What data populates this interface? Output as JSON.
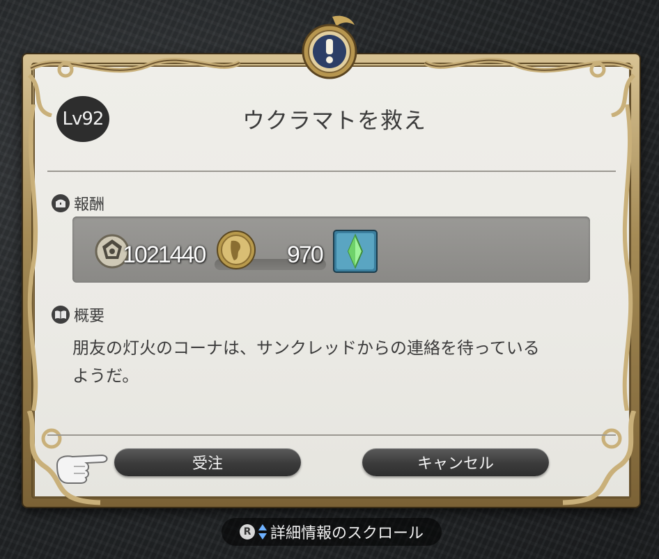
{
  "quest": {
    "level": "Lv92",
    "title": "ウクラマトを救え"
  },
  "rewards": {
    "header": "報酬",
    "gil": "1021440",
    "second_value": "970"
  },
  "summary": {
    "header": "概要",
    "text_line1": "朋友の灯火のコーナは、サンクレッドからの連絡を待っている",
    "text_line2": "ようだ。"
  },
  "buttons": {
    "accept": "受注",
    "cancel": "キャンセル"
  },
  "hint": {
    "key": "R",
    "text": "詳細情報のスクロール"
  },
  "icons": {
    "emblem": "exclamation-emblem-icon",
    "reward": "treasure-chest-icon",
    "summary": "open-book-icon",
    "gil": "gil-coin-icon",
    "tomestone": "tomestone-coin-icon",
    "crystal": "crystal-icon",
    "cursor": "pointing-hand-icon"
  },
  "colors": {
    "frame_gold": "#a58b56",
    "panel": "#efeee9",
    "crystal_green": "#8fe88a"
  }
}
